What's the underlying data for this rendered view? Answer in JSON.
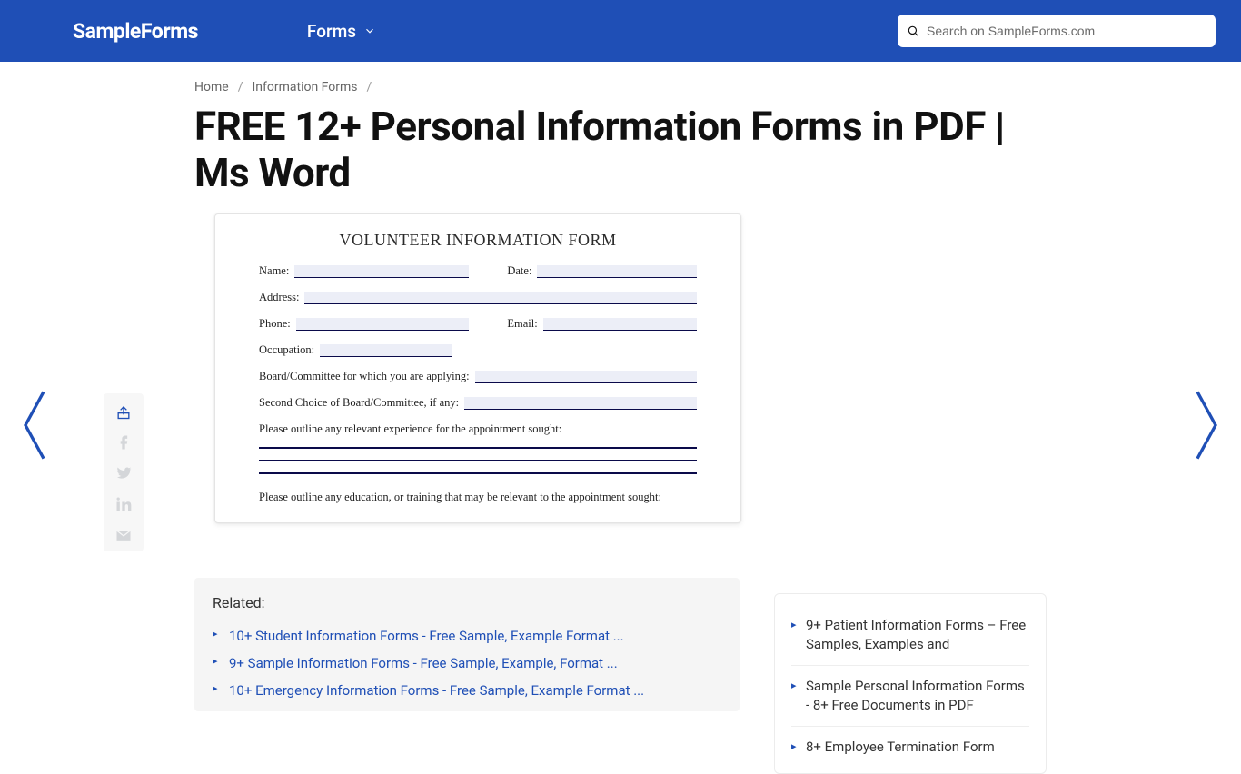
{
  "header": {
    "logo_a": "Sample",
    "logo_b": "Forms",
    "nav_forms": "Forms",
    "search_placeholder": "Search on SampleForms.com"
  },
  "crumbs": {
    "home": "Home",
    "cat": "Information Forms"
  },
  "title": "FREE 12+ Personal Information Forms in PDF | Ms Word",
  "form": {
    "heading": "VOLUNTEER INFORMATION FORM",
    "name": "Name:",
    "date": "Date:",
    "address": "Address:",
    "phone": "Phone:",
    "email": "Email:",
    "occupation": "Occupation:",
    "board": "Board/Committee for which you are applying:",
    "second": "Second Choice of Board/Committee, if any:",
    "exp": "Please outline any relevant experience for the appointment sought:",
    "edu": "Please outline any education, or training that may be relevant to the appointment sought:"
  },
  "related": {
    "heading": "Related:",
    "items": [
      "10+ Student Information Forms - Free Sample, Example Format ...",
      "9+ Sample Information Forms - Free Sample, Example, Format ...",
      "10+ Emergency Information Forms - Free Sample, Example Format ..."
    ]
  },
  "side": {
    "items": [
      "9+ Patient Information Forms – Free Samples, Examples and",
      "Sample Personal Information Forms - 8+ Free Documents in PDF",
      "8+ Employee Termination Form"
    ]
  }
}
